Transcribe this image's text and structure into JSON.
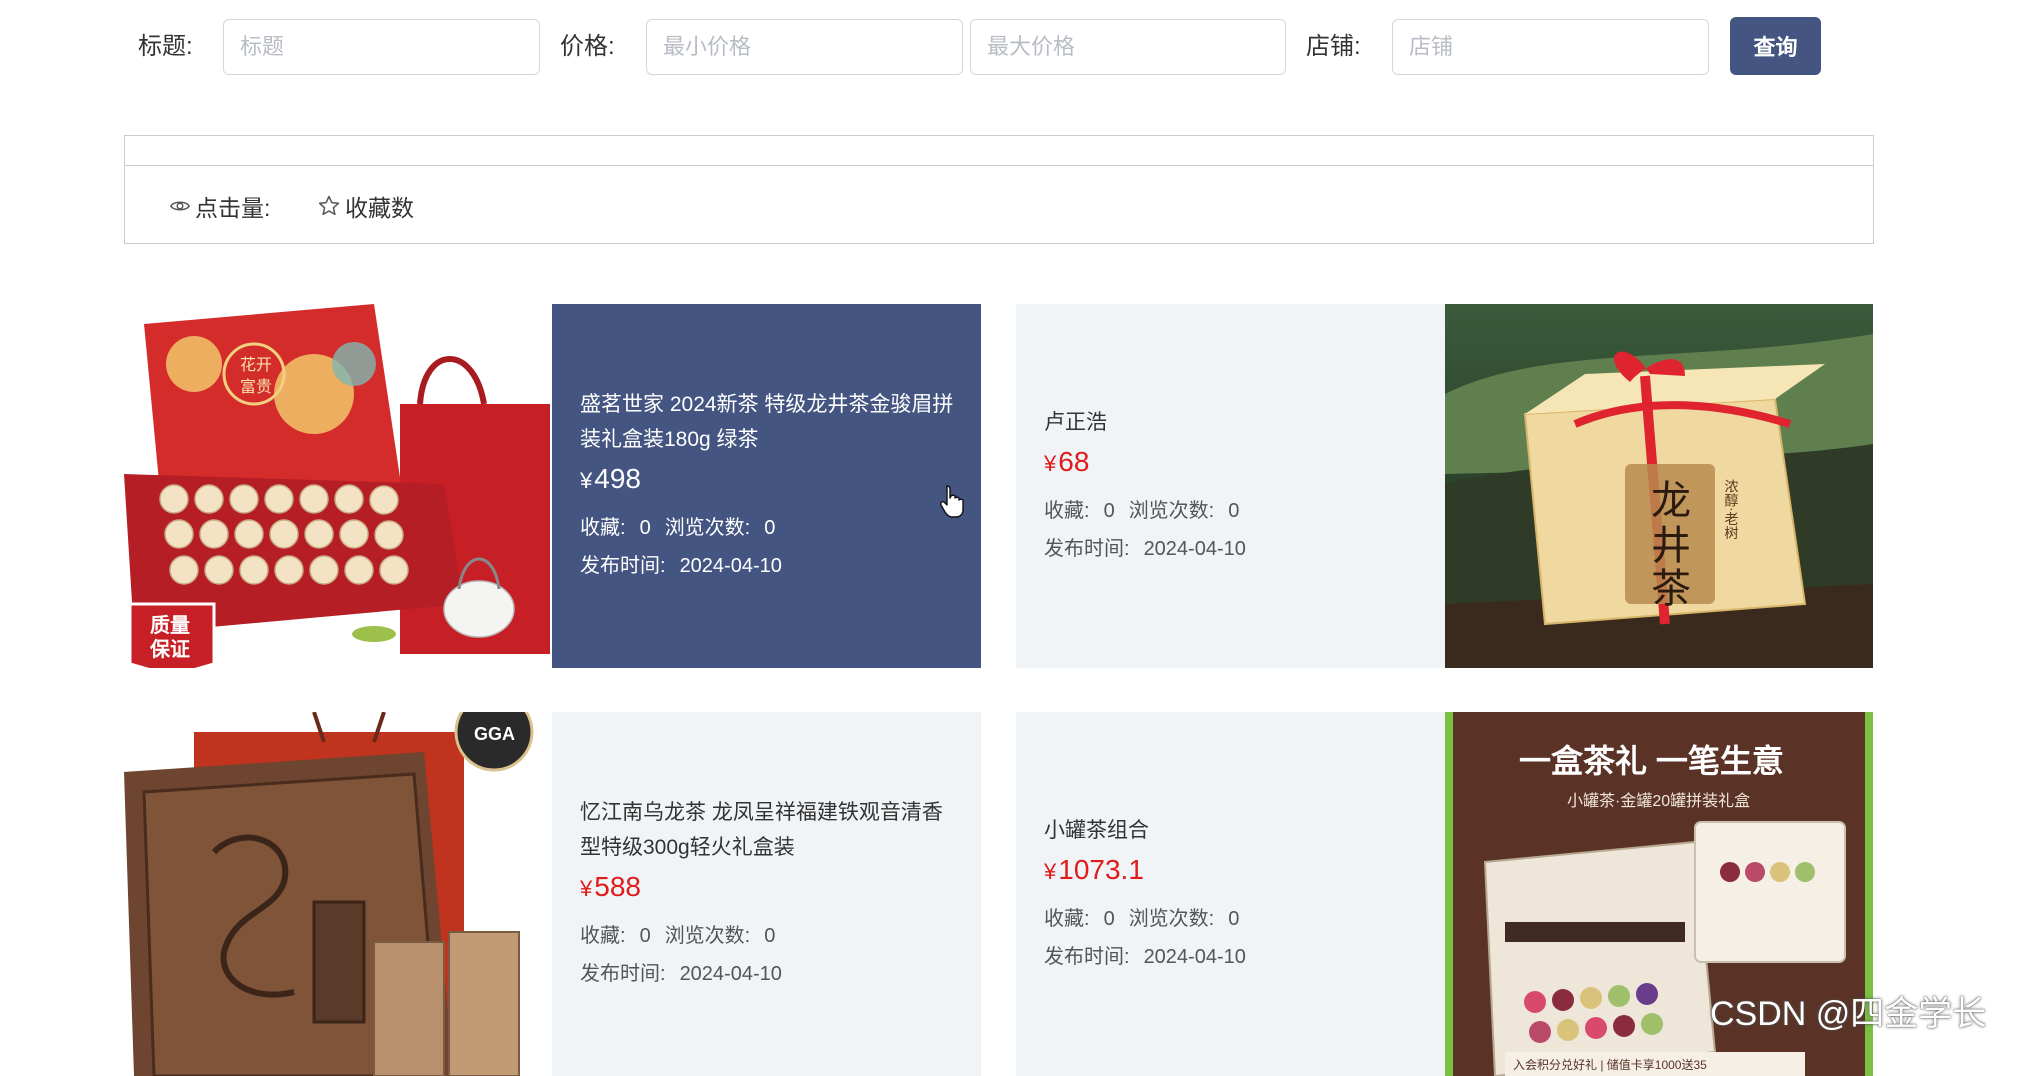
{
  "search": {
    "title_label": "标题:",
    "title_placeholder": "标题",
    "price_label": "价格:",
    "min_price_placeholder": "最小价格",
    "max_price_placeholder": "最大价格",
    "shop_label": "店铺:",
    "shop_placeholder": "店铺",
    "query_button": "查询"
  },
  "sort": {
    "clicks_label": "点击量:",
    "favorites_label": "收藏数"
  },
  "products": [
    {
      "title": "盛茗世家 2024新茶 特级龙井茶金骏眉拼装礼盒装180g 绿茶",
      "currency": "¥",
      "price": "498",
      "favorites_label": "收藏:",
      "favorites": "0",
      "views_label": "浏览次数:",
      "views": "0",
      "date_label": "发布时间:",
      "date": "2024-04-10",
      "badge_line1": "质量",
      "badge_line2": "保证",
      "box_text_1": "花开",
      "box_text_2": "富贵"
    },
    {
      "title": "卢正浩",
      "currency": "¥",
      "price": "68",
      "favorites_label": "收藏:",
      "favorites": "0",
      "views_label": "浏览次数:",
      "views": "0",
      "date_label": "发布时间:",
      "date": "2024-04-10",
      "package_text_1": "龙",
      "package_text_2": "井",
      "package_text_3": "茶",
      "package_side_text": "浓醇·老树"
    },
    {
      "title": "忆江南乌龙茶 龙凤呈祥福建铁观音清香型特级300g轻火礼盒装",
      "currency": "¥",
      "price": "588",
      "favorites_label": "收藏:",
      "favorites": "0",
      "views_label": "浏览次数:",
      "views": "0",
      "date_label": "发布时间:",
      "date": "2024-04-10",
      "seal_text": "GGA"
    },
    {
      "title": "小罐茶组合",
      "currency": "¥",
      "price": "1073.1",
      "favorites_label": "收藏:",
      "favorites": "0",
      "views_label": "浏览次数:",
      "views": "0",
      "date_label": "发布时间:",
      "date": "2024-04-10",
      "ad_headline": "一盒茶礼 一笔生意",
      "ad_subline": "小罐茶·金罐20罐拼装礼盒",
      "ad_bottom": "入会积分兑好礼  |  储值卡享1000送35"
    }
  ],
  "watermark": "CSDN @四金学长"
}
